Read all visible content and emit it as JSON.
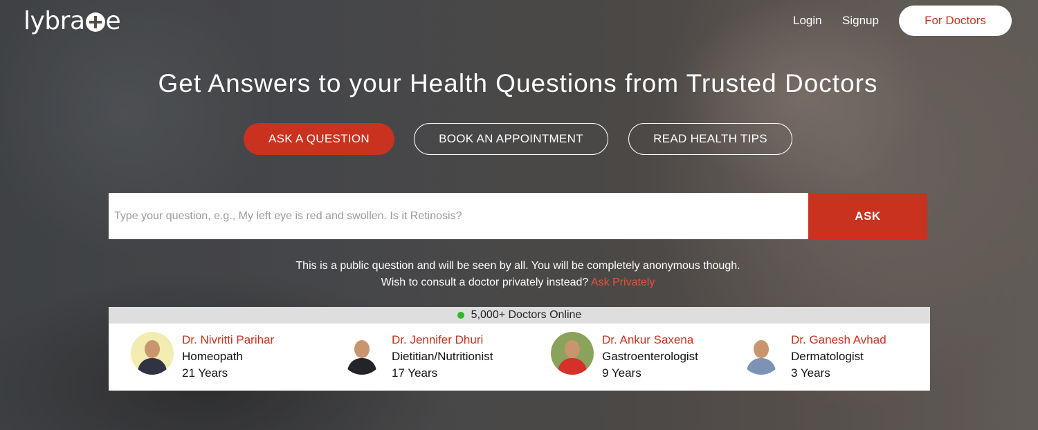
{
  "header": {
    "logo_text_left": "lybra",
    "logo_text_right": "e",
    "login": "Login",
    "signup": "Signup",
    "for_doctors": "For Doctors"
  },
  "hero": {
    "headline": "Get Answers to your Health Questions from Trusted Doctors",
    "actions": {
      "ask": "ASK A QUESTION",
      "book": "BOOK AN APPOINTMENT",
      "tips": "READ HEALTH TIPS"
    }
  },
  "search": {
    "placeholder": "Type your question, e.g., My left eye is red and swollen. Is it Retinosis?",
    "value": "",
    "button": "ASK"
  },
  "notice": {
    "line1": "This is a public question and will be seen by all. You will be completely anonymous though.",
    "line2": "Wish to consult a doctor privately instead?",
    "link": "Ask Privately"
  },
  "doctors": {
    "online_label": "5,000+ Doctors Online",
    "list": [
      {
        "name": "Dr. Nivritti Parihar",
        "specialty": "Homeopath",
        "experience": "21 Years",
        "avatar_bg": "#f3ecb0",
        "shirt": "#2f3342"
      },
      {
        "name": "Dr. Jennifer Dhuri",
        "specialty": "Dietitian/Nutritionist",
        "experience": "17 Years",
        "avatar_bg": "#ffffff",
        "shirt": "#23232a"
      },
      {
        "name": "Dr. Ankur Saxena",
        "specialty": "Gastroenterologist",
        "experience": "9 Years",
        "avatar_bg": "#8aa35a",
        "shirt": "#d6302a"
      },
      {
        "name": "Dr. Ganesh Avhad",
        "specialty": "Dermatologist",
        "experience": "3 Years",
        "avatar_bg": "#ffffff",
        "shirt": "#7c93b4"
      }
    ]
  },
  "colors": {
    "accent": "#c8321f",
    "link": "#e8513b",
    "online_dot": "#2fb82b"
  }
}
